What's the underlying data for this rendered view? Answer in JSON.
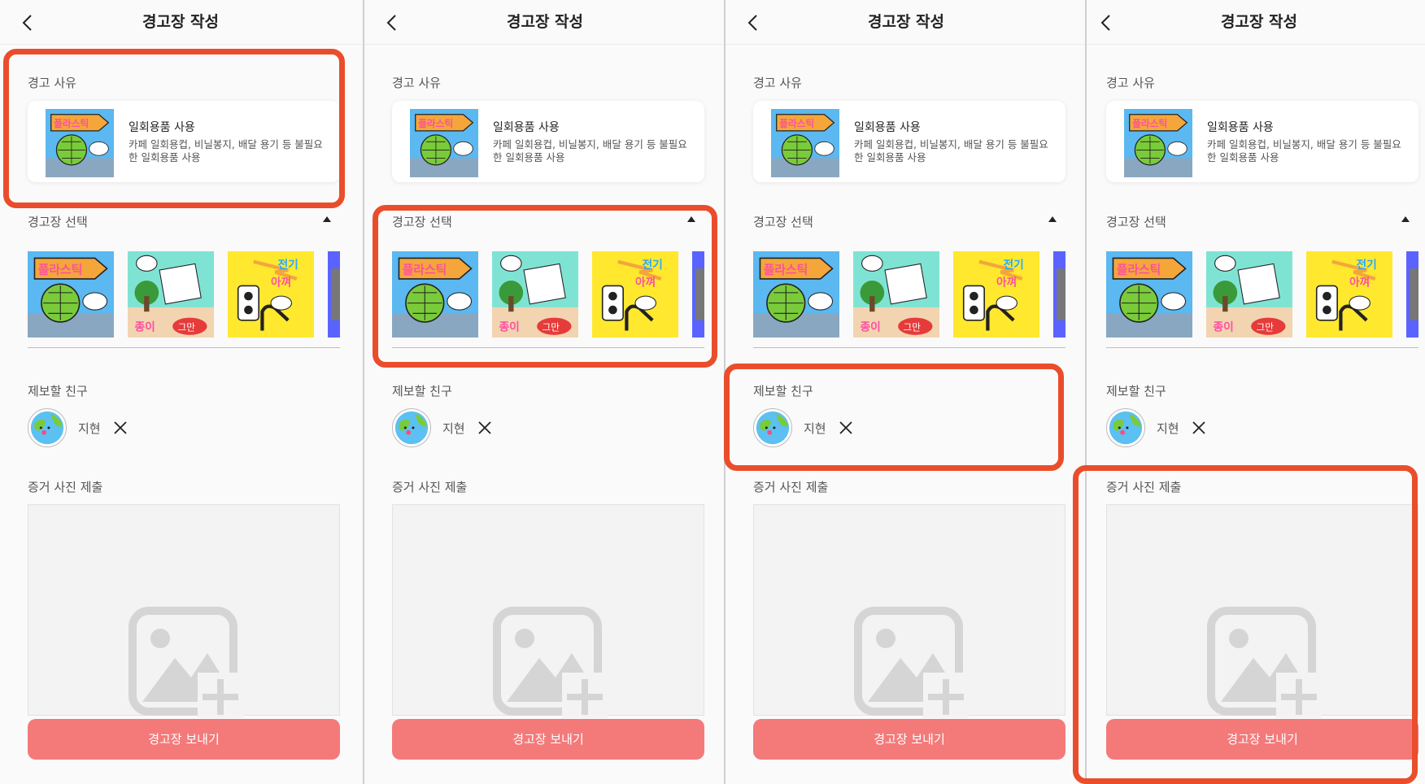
{
  "screens": [
    {
      "header": {
        "title": "경고장 작성"
      },
      "reason": {
        "label": "경고 사유",
        "card_title": "일회용품 사용",
        "card_desc": "카페 일회용컵, 비닐봉지, 배달 용기 등 불필요한 일회용품 사용"
      },
      "selection": {
        "label": "경고장 선택"
      },
      "friend": {
        "label": "제보할 친구",
        "name": "지현"
      },
      "evidence": {
        "label": "증거 사진 제출"
      },
      "submit_label": "경고장 보내기"
    },
    {
      "header": {
        "title": "경고장 작성"
      },
      "reason": {
        "label": "경고 사유",
        "card_title": "일회용품 사용",
        "card_desc": "카페 일회용컵, 비닐봉지, 배달 용기 등 불필요한 일회용품 사용"
      },
      "selection": {
        "label": "경고장 선택"
      },
      "friend": {
        "label": "제보할 친구",
        "name": "지현"
      },
      "evidence": {
        "label": "증거 사진 제출"
      },
      "submit_label": "경고장 보내기"
    },
    {
      "header": {
        "title": "경고장 작성"
      },
      "reason": {
        "label": "경고 사유",
        "card_title": "일회용품 사용",
        "card_desc": "카페 일회용컵, 비닐봉지, 배달 용기 등 불필요한 일회용품 사용"
      },
      "selection": {
        "label": "경고장 선택"
      },
      "friend": {
        "label": "제보할 친구",
        "name": "지현"
      },
      "evidence": {
        "label": "증거 사진 제출"
      },
      "submit_label": "경고장 보내기"
    },
    {
      "header": {
        "title": "경고장 작성"
      },
      "reason": {
        "label": "경고 사유",
        "card_title": "일회용품 사용",
        "card_desc": "카페 일회용컵, 비닐봉지, 배달 용기 등 불필요한 일회용품 사용"
      },
      "selection": {
        "label": "경고장 선택"
      },
      "friend": {
        "label": "제보할 친구",
        "name": "지현"
      },
      "evidence": {
        "label": "증거 사진 제출"
      },
      "submit_label": "경고장 보내기"
    }
  ],
  "warning_cards": [
    {
      "icon": "plastic-warning-card",
      "banner_text": "플라스틱",
      "caption_text": "",
      "background": "#5bb8f0"
    },
    {
      "icon": "paper-warning-card",
      "banner_text": "",
      "caption_text": "종이 그만",
      "background": "#7fe3d4"
    },
    {
      "icon": "electricity-warning-card",
      "banner_text": "전기 아껴",
      "caption_text": "",
      "background": "#ffe82e"
    },
    {
      "icon": "partial-warning-card",
      "banner_text": "",
      "caption_text": "",
      "background": "#5a63ff"
    }
  ],
  "highlight_color": "#ea4d2b",
  "button_color": "#f47a7a"
}
